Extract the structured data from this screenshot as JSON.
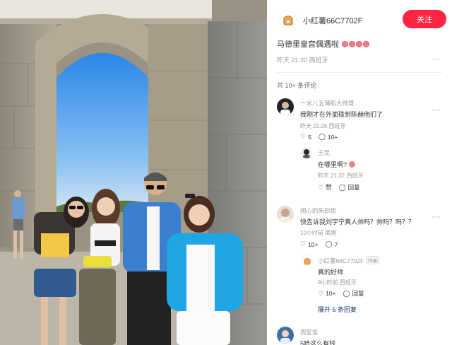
{
  "post": {
    "author_name": "小红薯66C7702F",
    "follow_label": "关注",
    "title": "马德里皇宫偶遇啦",
    "date": "昨天 21:20",
    "location": "西班牙"
  },
  "comments_header": "共 10+ 条评论",
  "comments": [
    {
      "user": "一米八五薄肌大帅哥",
      "text": "我刚才在外面碰到陈赫他们了",
      "date": "昨天 21:26",
      "location": "西班牙",
      "likes": "5",
      "replies_count": "10+",
      "replies": [
        {
          "user": "王昆",
          "text": "在哪里啊?",
          "date": "昨天 21:32",
          "location": "西班牙",
          "like_label": "赞",
          "reply_label": "回复"
        }
      ]
    },
    {
      "user": "闹心的朱砂痣",
      "text": "快告诉我刘宇宁真人帅吗？帅吗？吗？？",
      "date": "10小时前",
      "location": "美国",
      "likes": "10+",
      "replies_count": "7",
      "replies": [
        {
          "user": "小红薯66C7702F",
          "author_tag": "作者",
          "text": "真的好帅",
          "date": "9小时前",
          "location": "西班牙",
          "likes": "10+",
          "reply_label": "回复"
        }
      ],
      "expand_label": "展开 6 条回复"
    },
    {
      "user": "周笙笙",
      "text": "5哈这么有钱"
    }
  ],
  "colors": {
    "accent": "#ff2442",
    "link": "#13386c",
    "muted": "#999999"
  },
  "icons": [
    "more-icon",
    "heart-icon",
    "comment-bubble-icon",
    "author-avatar-icon"
  ]
}
